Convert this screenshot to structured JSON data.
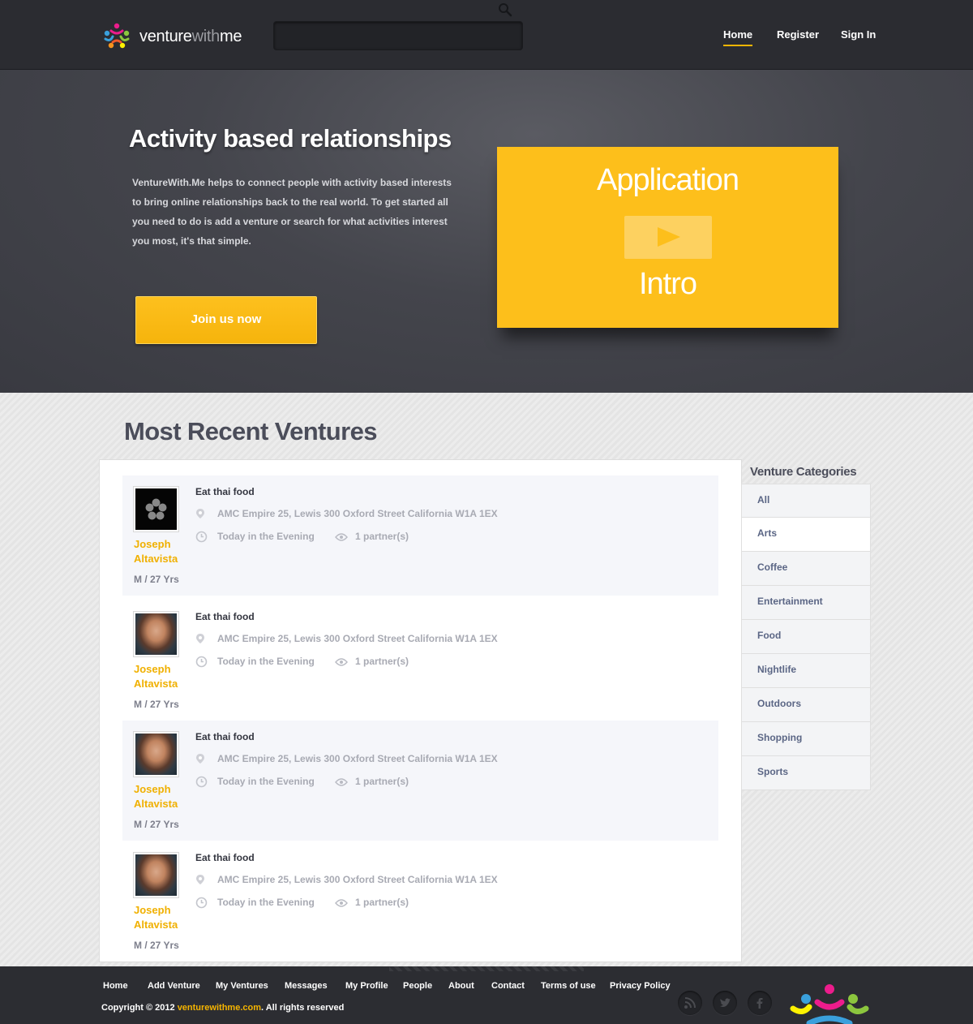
{
  "header": {
    "logo_bold": "venture",
    "logo_light": "with",
    "logo_end": "me",
    "search_value": "",
    "nav": [
      "Home",
      "Register",
      "Sign In"
    ],
    "active_nav": "Home"
  },
  "hero": {
    "title": "Activity based relationships",
    "text": "VentureWith.Me helps to connect people with activity based interests to bring online relationships back to the real world. To get started all you need to do is add a venture or search for what activities interest you most, it's that simple.",
    "join_label": "Join us now",
    "video_top": "Application",
    "video_bottom": "Intro"
  },
  "main": {
    "section_title": "Most Recent Ventures",
    "ventures": [
      {
        "title": "Eat thai food",
        "location": "AMC Empire 25, Lewis 300 Oxford Street California W1A 1EX",
        "time": "Today in the Evening",
        "partners": "1 partner(s)",
        "name_first": "Joseph",
        "name_last": "Altavista",
        "meta": "M / 27 Yrs",
        "avatar": "dark-logo"
      },
      {
        "title": "Eat thai food",
        "location": "AMC Empire 25, Lewis 300 Oxford Street California W1A 1EX",
        "time": "Today in the Evening",
        "partners": "1 partner(s)",
        "name_first": "Joseph",
        "name_last": "Altavista",
        "meta": "M / 27 Yrs",
        "avatar": "photo"
      },
      {
        "title": "Eat thai food",
        "location": "AMC Empire 25, Lewis 300 Oxford Street California W1A 1EX",
        "time": "Today in the Evening",
        "partners": "1 partner(s)",
        "name_first": "Joseph",
        "name_last": "Altavista",
        "meta": "M / 27 Yrs",
        "avatar": "photo"
      },
      {
        "title": "Eat thai food",
        "location": "AMC Empire 25, Lewis 300 Oxford Street California W1A 1EX",
        "time": "Today in the Evening",
        "partners": "1 partner(s)",
        "name_first": "Joseph",
        "name_last": "Altavista",
        "meta": "M / 27 Yrs",
        "avatar": "photo"
      }
    ],
    "categories_title": "Venture Categories",
    "categories": [
      "All",
      "Arts",
      "Coffee",
      "Entertainment",
      "Food",
      "Nightlife",
      "Outdoors",
      "Shopping",
      "Sports"
    ],
    "selected_category": "Arts"
  },
  "footer": {
    "nav": [
      "Home",
      "Add Venture",
      "My Ventures",
      "Messages",
      "My Profile",
      "People",
      "About",
      "Contact",
      "Terms of use",
      "Privacy Policy"
    ],
    "copyright_prefix": "Copyright © 2012 ",
    "copyright_link": "venturewithme.com",
    "copyright_suffix": ". All rights reserved",
    "social_icons": [
      "rss-icon",
      "twitter-icon",
      "facebook-icon"
    ]
  },
  "colors": {
    "accent": "#fdbf1b",
    "header_bg": "#2b2c31",
    "hero_bg": "#44454c",
    "title_dark": "#4b4d5a",
    "link_yellow": "#f0b000"
  }
}
